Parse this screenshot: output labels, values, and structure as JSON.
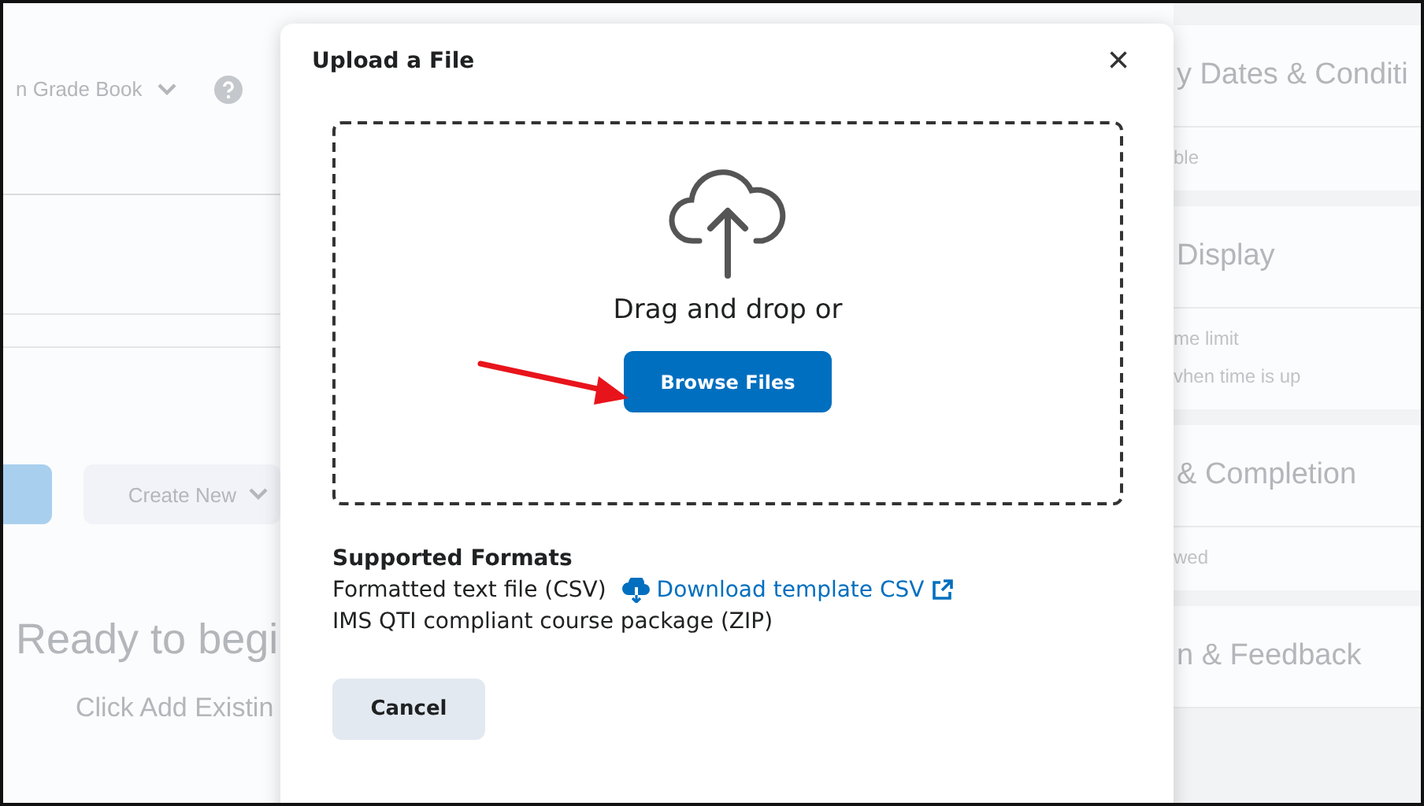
{
  "background": {
    "left": {
      "header_link": "n Grade Book",
      "create_button": "Create New",
      "empty_title": "Ready to begi",
      "empty_text": "Click Add Existin"
    },
    "right_sections": [
      {
        "title": "y Dates & Conditi",
        "lines": [
          "ble"
        ]
      },
      {
        "title": "Display",
        "lines": [
          "me limit",
          "vhen time is up"
        ]
      },
      {
        "title": "& Completion",
        "lines": [
          "wed"
        ]
      },
      {
        "title": "n & Feedback"
      }
    ]
  },
  "dialog": {
    "title": "Upload a File",
    "close": "×",
    "drop_text": "Drag and drop or",
    "browse_button": "Browse Files",
    "formats_heading": "Supported Formats",
    "formats": [
      {
        "text": "Formatted text file (CSV)",
        "link": "Download template CSV"
      },
      {
        "text": "IMS QTI compliant course package (ZIP)"
      }
    ],
    "cancel_button": "Cancel"
  }
}
